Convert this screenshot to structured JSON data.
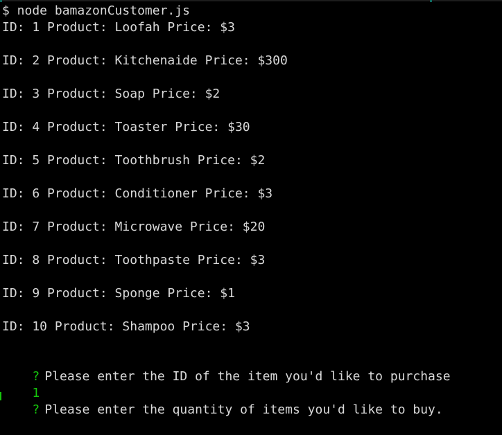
{
  "terminal": {
    "command_line": "$ node bamazonCustomer.js",
    "products": [
      "ID: 1 Product: Loofah Price: $3",
      "ID: 2 Product: Kitchenaide Price: $300",
      "ID: 3 Product: Soap Price: $2",
      "ID: 4 Product: Toaster Price: $30",
      "ID: 5 Product: Toothbrush Price: $2",
      "ID: 6 Product: Conditioner Price: $3",
      "ID: 7 Product: Microwave Price: $20",
      "ID: 8 Product: Toothpaste Price: $3",
      "ID: 9 Product: Sponge Price: $1",
      "ID: 10 Product: Shampoo Price: $3"
    ],
    "prompt_symbol": "?",
    "question_1": "Please enter the ID of the item you'd like to purchase",
    "answer_1": "1",
    "question_2": "Please enter the quantity of items you'd like to buy.",
    "colors": {
      "background": "#000000",
      "text": "#d9d9d9",
      "prompt_green": "#16c60c"
    }
  }
}
